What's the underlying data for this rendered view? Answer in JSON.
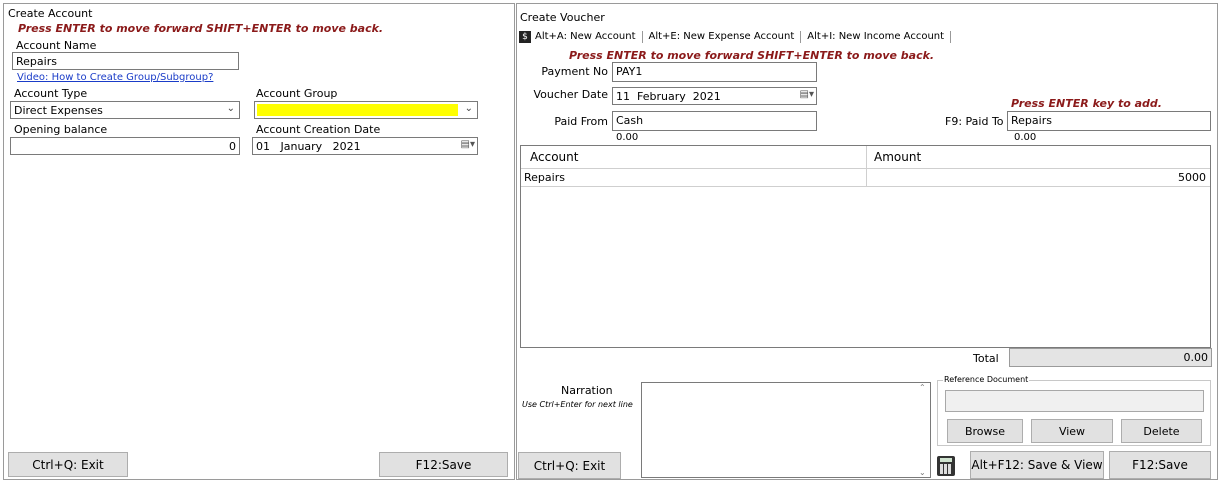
{
  "left": {
    "title": "Create Account",
    "hint": "Press ENTER to move forward  SHIFT+ENTER to move back.",
    "account_name_label": "Account Name",
    "account_name_value": "Repairs",
    "video_link": "Video: How to Create Group/Subgroup?",
    "account_type_label": "Account Type",
    "account_type_value": "Direct Expenses",
    "account_group_label": "Account Group",
    "account_group_value": "",
    "opening_balance_label": "Opening balance",
    "opening_balance_value": "0",
    "creation_date_label": "Account Creation Date",
    "creation_date_value": "01   January   2021",
    "exit_button": "Ctrl+Q: Exit",
    "save_button": "F12:Save"
  },
  "right": {
    "title": "Create Voucher",
    "toolbar": {
      "item1": "Alt+A: New Account",
      "item2": "Alt+E: New Expense Account",
      "item3": "Alt+I: New Income Account"
    },
    "hint": "Press ENTER to move forward  SHIFT+ENTER to move back.",
    "payment_no_label": "Payment No",
    "payment_no_value": "PAY1",
    "voucher_date_label": "Voucher Date",
    "voucher_date_value": "11  February  2021",
    "paid_from_label": "Paid From",
    "paid_from_value": "Cash",
    "paid_from_balance": "0.00",
    "add_hint": "Press ENTER key to add.",
    "paid_to_label": "F9: Paid To",
    "paid_to_value": "Repairs",
    "paid_to_balance": "0.00",
    "grid": {
      "col_account": "Account",
      "col_amount": "Amount",
      "rows": [
        {
          "account": "Repairs",
          "amount": "5000"
        }
      ]
    },
    "total_label": "Total",
    "total_value": "0.00",
    "narration_label": "Narration",
    "narration_hint": "Use Ctrl+Enter for next line",
    "narration_value": "",
    "reference_label": "Reference Document",
    "reference_value": "",
    "browse_button": "Browse",
    "view_button": "View",
    "delete_button": "Delete",
    "exit_button": "Ctrl+Q: Exit",
    "save_view_button": "Alt+F12: Save & View",
    "save_button": "F12:Save"
  },
  "colors": {
    "hint": "#8b1a1a",
    "highlight": "#ffff00",
    "button_bg": "#e1e1e1"
  }
}
